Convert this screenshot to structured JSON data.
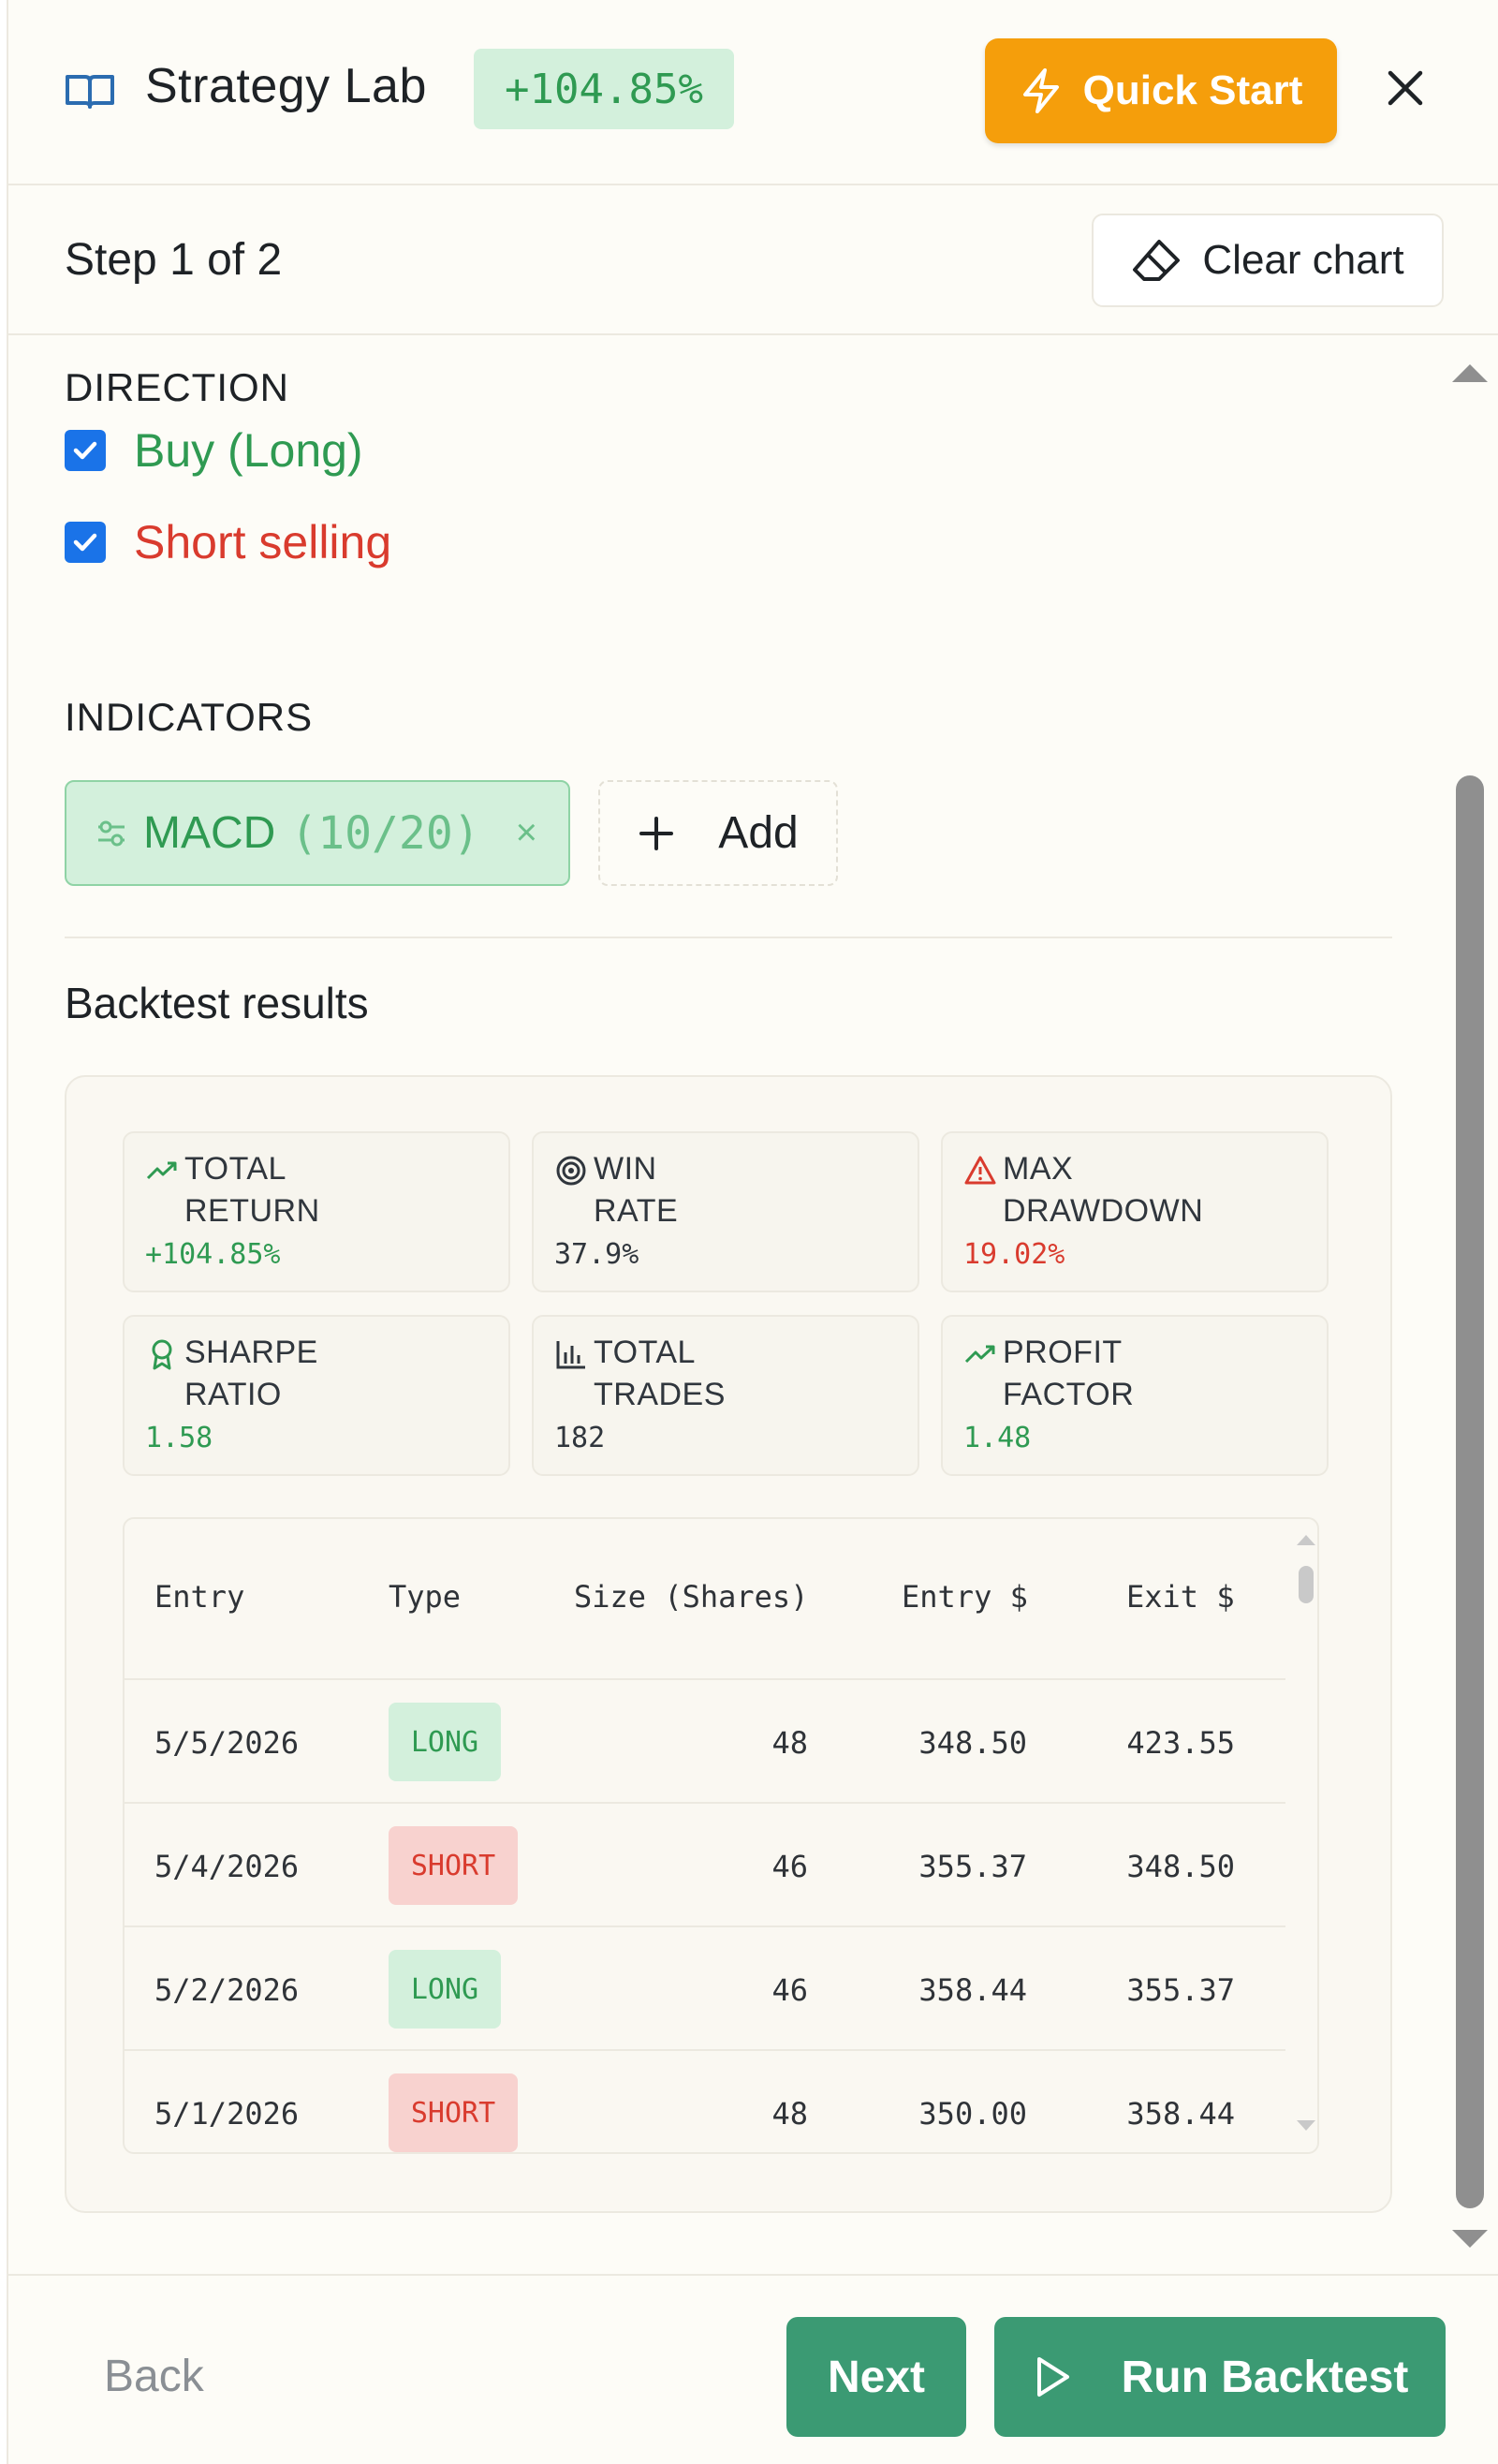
{
  "header": {
    "title": "Strategy Lab",
    "return_badge": "+104.85%",
    "quick_start_label": "Quick Start"
  },
  "stepbar": {
    "step_label": "Step 1 of 2",
    "clear_chart_label": "Clear chart"
  },
  "direction": {
    "section_label": "DIRECTION",
    "buy_label": "Buy (Long)",
    "buy_checked": true,
    "short_label": "Short selling",
    "short_checked": true
  },
  "indicators": {
    "section_label": "INDICATORS",
    "chip_name": "MACD",
    "chip_params": "(10/20)",
    "chip_remove": "×",
    "add_label": "Add"
  },
  "results": {
    "title": "Backtest results",
    "metrics": [
      {
        "label_line1": "TOTAL",
        "label_line2": "RETURN",
        "value": "+104.85%",
        "icon": "trend-up-icon",
        "tone": "green"
      },
      {
        "label_line1": "WIN",
        "label_line2": "RATE",
        "value": "37.9%",
        "icon": "target-icon",
        "tone": "dark"
      },
      {
        "label_line1": "MAX",
        "label_line2": "DRAWDOWN",
        "value": "19.02%",
        "icon": "warning-icon",
        "tone": "red"
      },
      {
        "label_line1": "SHARPE",
        "label_line2": "RATIO",
        "value": "1.58",
        "icon": "award-icon",
        "tone": "green"
      },
      {
        "label_line1": "TOTAL",
        "label_line2": "TRADES",
        "value": "182",
        "icon": "bar-chart-icon",
        "tone": "dark"
      },
      {
        "label_line1": "PROFIT",
        "label_line2": "FACTOR",
        "value": "1.48",
        "icon": "trend-up-icon",
        "tone": "green"
      }
    ],
    "table": {
      "columns": [
        "Entry",
        "Type",
        "Size (Shares)",
        "Entry $",
        "Exit $"
      ],
      "rows": [
        {
          "entry": "5/5/2026",
          "type": "LONG",
          "size": "48",
          "entry_price": "348.50",
          "exit_price": "423.55"
        },
        {
          "entry": "5/4/2026",
          "type": "SHORT",
          "size": "46",
          "entry_price": "355.37",
          "exit_price": "348.50"
        },
        {
          "entry": "5/2/2026",
          "type": "LONG",
          "size": "46",
          "entry_price": "358.44",
          "exit_price": "355.37"
        },
        {
          "entry": "5/1/2026",
          "type": "SHORT",
          "size": "48",
          "entry_price": "350.00",
          "exit_price": "358.44"
        }
      ]
    }
  },
  "footer": {
    "back_label": "Back",
    "next_label": "Next",
    "run_label": "Run Backtest"
  },
  "colors": {
    "accent_orange": "#f59e0b",
    "positive_green": "#2f9a52",
    "negative_red": "#d93b2e",
    "primary_button": "#3b9a73",
    "checkbox_blue": "#1a73e8"
  }
}
